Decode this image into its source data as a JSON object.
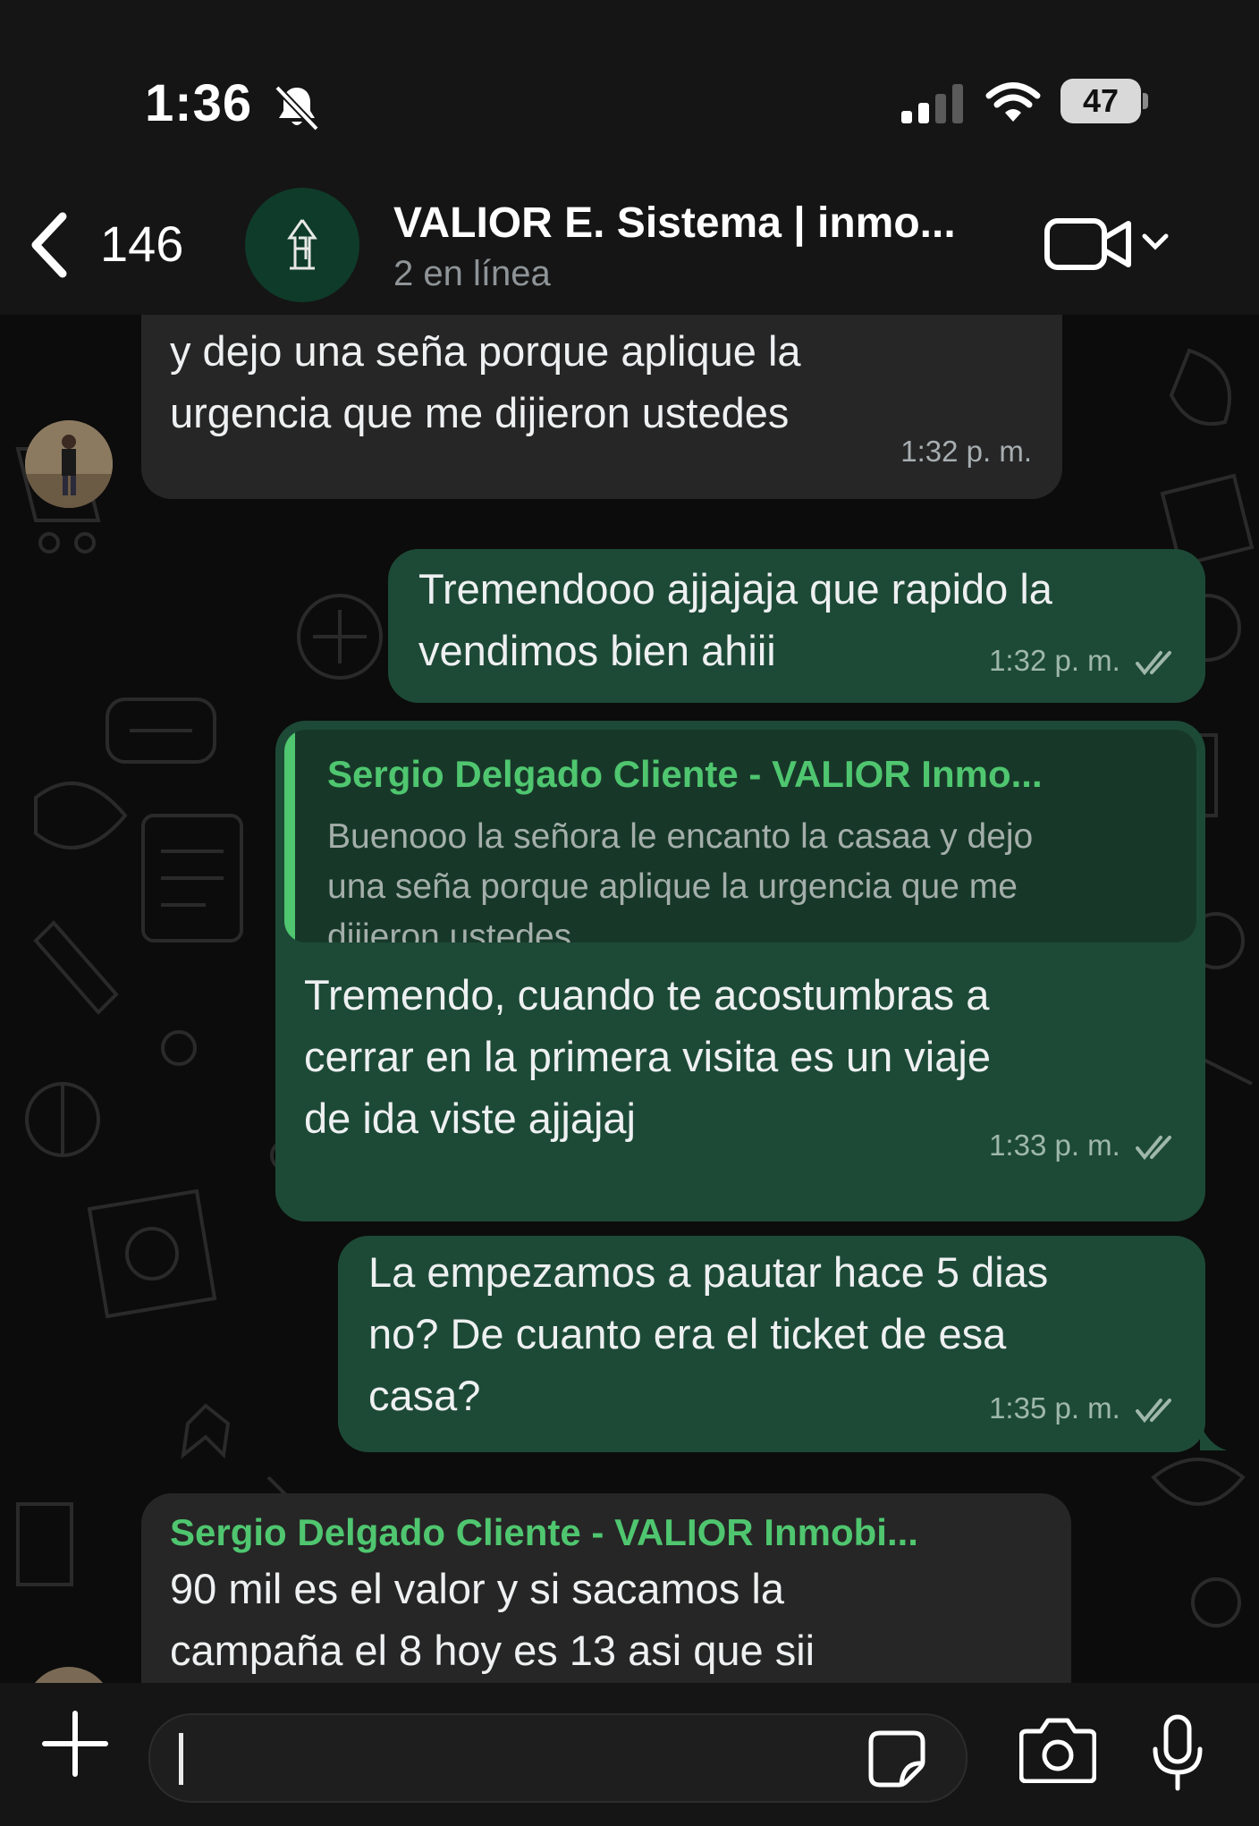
{
  "status_bar": {
    "time": "1:36",
    "battery": "47"
  },
  "header": {
    "back_count": "146",
    "title": "VALIOR E. Sistema | inmo...",
    "subtitle": "2 en línea"
  },
  "messages": [
    {
      "direction": "incoming",
      "lines": [
        "y dejo una seña porque aplique la",
        "urgencia que me dijieron ustedes"
      ],
      "time": "1:32 p. m."
    },
    {
      "direction": "outgoing",
      "lines": [
        "Tremendooo ajjajaja que rapido la",
        "vendimos bien ahiii"
      ],
      "time": "1:32 p. m."
    },
    {
      "direction": "outgoing",
      "quote": {
        "author": "Sergio Delgado Cliente - VALIOR Inmo...",
        "lines": [
          "Buenooo la señora le encanto la casaa y dejo",
          "una seña porque aplique la urgencia que me",
          "dijieron ustedes"
        ]
      },
      "lines": [
        "Tremendo, cuando te acostumbras a",
        "cerrar en la primera visita es un viaje",
        "de ida viste ajjajaj"
      ],
      "time": "1:33 p. m."
    },
    {
      "direction": "outgoing",
      "lines": [
        "La empezamos a pautar hace 5 dias",
        "no? De cuanto era el ticket de esa",
        "casa?"
      ],
      "time": "1:35 p. m."
    },
    {
      "direction": "incoming",
      "sender": "Sergio Delgado Cliente - VALIOR Inmobi...",
      "lines": [
        "90 mil es el valor y si sacamos la",
        "campaña el 8 hoy es 13 asi que sii"
      ]
    }
  ],
  "icons": [
    "mute-bell-icon",
    "signal-icon",
    "wifi-icon",
    "battery-icon",
    "back-chevron-icon",
    "video-call-icon",
    "chevron-down-icon",
    "plus-icon",
    "sticker-icon",
    "camera-icon",
    "microphone-icon",
    "double-check-icon"
  ],
  "colors": {
    "outgoing_bubble": "#1d4a37",
    "incoming_bubble": "#262626",
    "sender_green": "#4fc66f"
  }
}
